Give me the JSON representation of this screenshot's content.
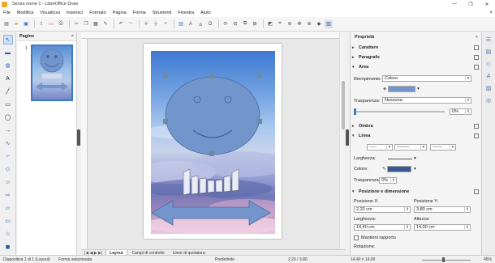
{
  "window": {
    "title": "Senza nome 1 - LibreOffice Draw",
    "controls": [
      "—",
      "❐",
      "✕"
    ]
  },
  "menu": [
    "File",
    "Modifica",
    "Visualizza",
    "Inserisci",
    "Formato",
    "Pagina",
    "Forma",
    "Strumenti",
    "Finestra",
    "Aiuto"
  ],
  "pages_panel": {
    "title": "Pagine",
    "close": "×",
    "page_number": "1"
  },
  "tabs": {
    "nav": "|◀ ◀ ▶ ▶|",
    "items": [
      "Layout",
      "Campi di controllo",
      "Linee di quotatura"
    ]
  },
  "sidebar": {
    "title": "Proprietà",
    "close": "×",
    "sections": {
      "carattere": "Carattere",
      "paragrafo": "Paragrafo",
      "area": "Area",
      "ombra": "Ombra",
      "linea": "Linea",
      "posizione": "Posizione e dimensione"
    },
    "area": {
      "fill_label": "Riempimento:",
      "fill_value": "Colore",
      "transparency_label": "Trasparenza:",
      "transparency_value": "Nessuna",
      "transparency_pct": "0%"
    },
    "linea": {
      "width_label": "Larghezza:",
      "color_label": "Colore:",
      "transparency_label": "Trasparenza:",
      "transparency_value": "0%"
    },
    "posizione": {
      "pos_x_label": "Posizione X:",
      "pos_x_value": "2,20 cm",
      "pos_y_label": "Posizione Y:",
      "pos_y_value": "3,80 cm",
      "width_label": "Larghezza:",
      "width_value": "14,40 cm",
      "height_label": "Altezza:",
      "height_value": "14,00 cm",
      "keep_ratio": "Mantieni rapporto",
      "rotation_label": "Rotazione:"
    }
  },
  "status": {
    "slide": "Diapositiva 1 di 1 (Layout)",
    "selection": "Forma selezionata",
    "layout": "Predefinito",
    "position": "2,20 / 3,80",
    "size": "14,40 x 14,00",
    "zoom": "45%"
  },
  "colors": {
    "accent": "#3e7bc4",
    "shape_fill": "#7296cb",
    "line_color": "#36598f"
  }
}
